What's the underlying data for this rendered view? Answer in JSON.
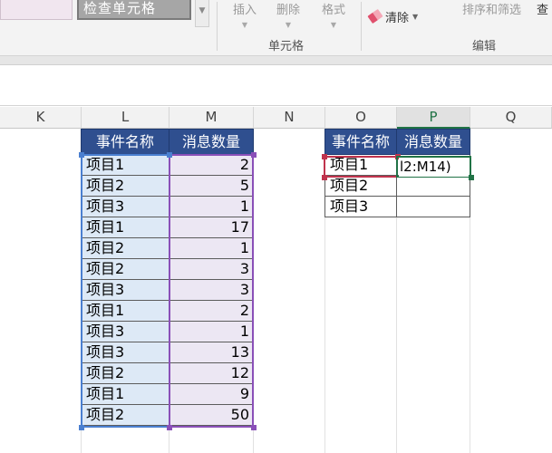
{
  "ribbon": {
    "style_check_label": "检查单元格",
    "insert_label": "插入",
    "delete_label": "删除",
    "format_label": "格式",
    "cells_group_label": "单元格",
    "clear_label": "清除",
    "sort_filter_label": "排序和筛选",
    "find_label": "查",
    "edit_group_label": "编辑"
  },
  "columns": [
    "K",
    "L",
    "M",
    "N",
    "O",
    "P",
    "Q"
  ],
  "active_column": "P",
  "source_table": {
    "headers": [
      "事件名称",
      "消息数量"
    ],
    "rows": [
      {
        "name": "项目1",
        "count": "2"
      },
      {
        "name": "项目2",
        "count": "5"
      },
      {
        "name": "项目3",
        "count": "1"
      },
      {
        "name": "项目1",
        "count": "17"
      },
      {
        "name": "项目2",
        "count": "1"
      },
      {
        "name": "项目2",
        "count": "3"
      },
      {
        "name": "项目3",
        "count": "3"
      },
      {
        "name": "项目1",
        "count": "2"
      },
      {
        "name": "项目3",
        "count": "1"
      },
      {
        "name": "项目3",
        "count": "13"
      },
      {
        "name": "项目2",
        "count": "12"
      },
      {
        "name": "项目1",
        "count": "9"
      },
      {
        "name": "项目2",
        "count": "50"
      }
    ]
  },
  "summary_table": {
    "headers": [
      "事件名称",
      "消息数量"
    ],
    "rows": [
      {
        "name": "项目1",
        "count": ""
      },
      {
        "name": "项目2",
        "count": ""
      },
      {
        "name": "项目3",
        "count": ""
      }
    ],
    "editing_formula_tail": "l2:M14)"
  },
  "colors": {
    "header_fill": "#2f4f8f",
    "range_l_border": "#4a7fd0",
    "range_m_border": "#8a50b8",
    "ref_cell_border": "#c0334d",
    "active_cell_border": "#217346"
  }
}
